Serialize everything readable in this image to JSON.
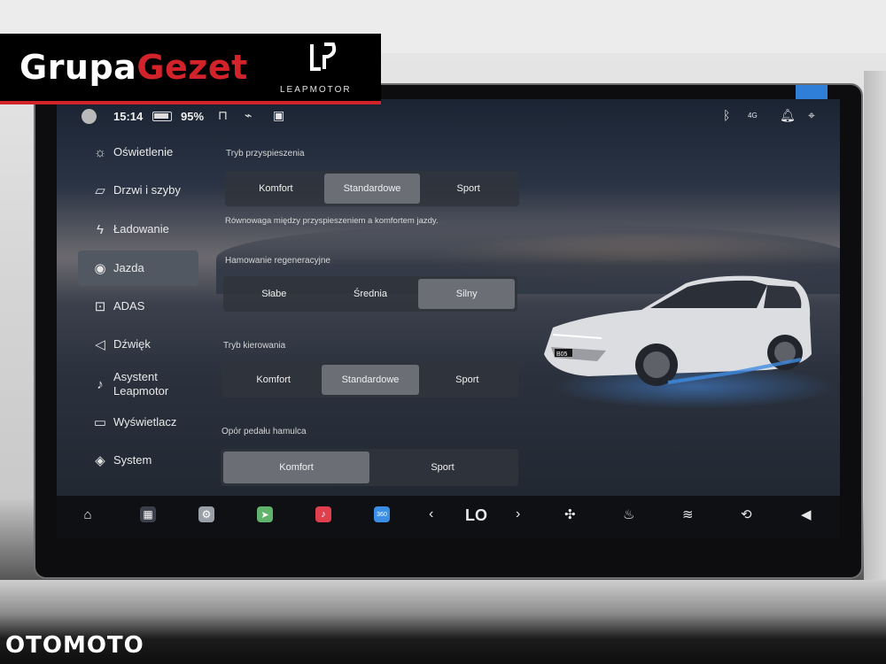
{
  "watermarks": {
    "brand_part1": "Grupa",
    "brand_part2": "Gezet",
    "leapmotor": "LEAPMOTOR",
    "otomoto": "OTOMOTO"
  },
  "status_bar": {
    "time": "15:14",
    "battery_pct": "95%",
    "icons": [
      "user-icon",
      "battery-icon",
      "lock-icon",
      "charge-icon",
      "camera-icon",
      "bluetooth-icon",
      "signal-4g-icon",
      "bell-icon",
      "location-icon"
    ],
    "signal_label": "4G"
  },
  "sidebar": {
    "items": [
      {
        "label": "Oświetlenie",
        "icon": "sun-icon",
        "glyph": "☼",
        "active": false
      },
      {
        "label": "Drzwi i szyby",
        "icon": "door-icon",
        "glyph": "▱",
        "active": false
      },
      {
        "label": "Ładowanie",
        "icon": "charging-icon",
        "glyph": "ϟ",
        "active": false
      },
      {
        "label": "Jazda",
        "icon": "steering-wheel-icon",
        "glyph": "◉",
        "active": true
      },
      {
        "label": "ADAS",
        "icon": "adas-icon",
        "glyph": "⊡",
        "active": false
      },
      {
        "label": "Dźwięk",
        "icon": "speaker-icon",
        "glyph": "◁",
        "active": false
      },
      {
        "label_line1": "Asystent",
        "label_line2": "Leapmotor",
        "icon": "microphone-icon",
        "glyph": "♪",
        "active": false
      },
      {
        "label": "Wyświetlacz",
        "icon": "display-icon",
        "glyph": "▭",
        "active": false
      },
      {
        "label": "System",
        "icon": "layers-icon",
        "glyph": "◈",
        "active": false
      }
    ]
  },
  "settings": {
    "acceleration": {
      "title": "Tryb przyspieszenia",
      "options": [
        "Komfort",
        "Standardowe",
        "Sport"
      ],
      "selected": "Standardowe",
      "description": "Równowaga między przyspieszeniem a komfortem jazdy."
    },
    "regen": {
      "title": "Hamowanie regeneracyjne",
      "options": [
        "Słabe",
        "Średnia",
        "Silny"
      ],
      "selected": "Silny"
    },
    "steering": {
      "title": "Tryb kierowania",
      "options": [
        "Komfort",
        "Standardowe",
        "Sport"
      ],
      "selected": "Standardowe"
    },
    "brake_pedal": {
      "title": "Opór pedału hamulca",
      "options": [
        "Komfort",
        "Sport"
      ],
      "selected": "Komfort"
    }
  },
  "car": {
    "badge": "B05"
  },
  "dock": {
    "apps": [
      "home-icon",
      "apps-grid-icon",
      "settings-icon",
      "maps-icon",
      "music-icon",
      "camera-360-icon"
    ],
    "app_360_label": "360",
    "temp_value": "LO",
    "climate": [
      "fan-icon",
      "seat-heat-icon",
      "defrost-icon",
      "recirculation-icon",
      "volume-icon"
    ]
  },
  "colors": {
    "accent_red": "#d2232a",
    "selected_bg": "#6b6e75",
    "active_menu_bg": "#525861",
    "car_glow": "#3f8be0"
  }
}
